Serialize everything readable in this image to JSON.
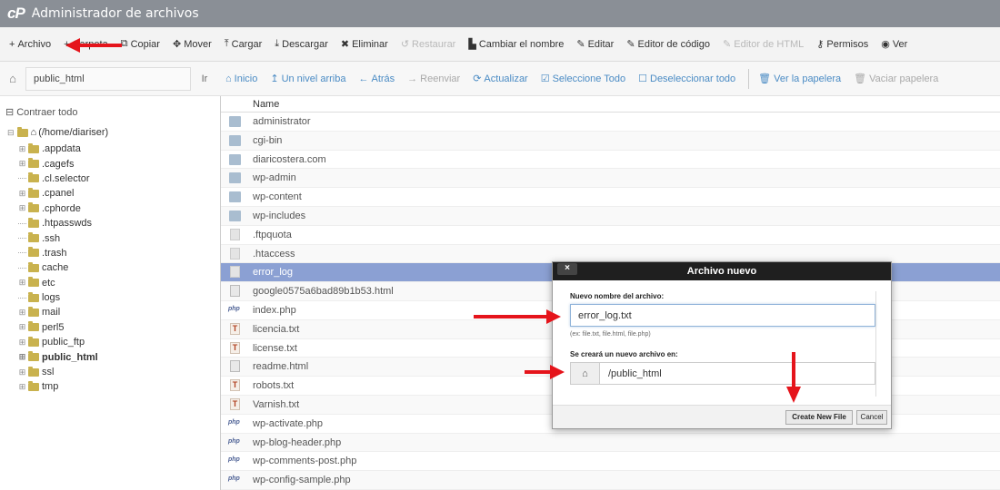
{
  "titlebar": {
    "logo": "cP",
    "title": "Administrador de archivos"
  },
  "toolbar": {
    "items": [
      {
        "label": "Archivo",
        "icon": "+",
        "disabled": false
      },
      {
        "label": "Carpeta",
        "icon": "+",
        "disabled": false
      },
      {
        "label": "Copiar",
        "icon": "⧉",
        "disabled": false
      },
      {
        "label": "Mover",
        "icon": "✥",
        "disabled": false
      },
      {
        "label": "Cargar",
        "icon": "⤒",
        "disabled": false
      },
      {
        "label": "Descargar",
        "icon": "⤓",
        "disabled": false
      },
      {
        "label": "Eliminar",
        "icon": "✖",
        "disabled": false
      },
      {
        "label": "Restaurar",
        "icon": "↺",
        "disabled": true
      },
      {
        "label": "Cambiar el nombre",
        "icon": "▙",
        "disabled": false
      },
      {
        "label": "Editar",
        "icon": "✎",
        "disabled": false
      },
      {
        "label": "Editor de código",
        "icon": "✎",
        "disabled": false
      },
      {
        "label": "Editor de HTML",
        "icon": "✎",
        "disabled": true
      },
      {
        "label": "Permisos",
        "icon": "⚷",
        "disabled": false
      },
      {
        "label": "Ver",
        "icon": "◉",
        "disabled": false
      }
    ]
  },
  "pathbar": {
    "path": "public_html",
    "go_label": "Ir",
    "nav": [
      {
        "label": "Inicio",
        "icon": "⌂",
        "disabled": false
      },
      {
        "label": "Un nivel arriba",
        "icon": "↥",
        "disabled": false
      },
      {
        "label": "Atrás",
        "icon": "←",
        "disabled": false
      },
      {
        "label": "Reenviar",
        "icon": "→",
        "disabled": true
      },
      {
        "label": "Actualizar",
        "icon": "⟳",
        "disabled": false
      },
      {
        "label": "Seleccione Todo",
        "icon": "☑",
        "disabled": false
      },
      {
        "label": "Deseleccionar todo",
        "icon": "☐",
        "disabled": false
      },
      {
        "label": "Ver la papelera",
        "icon": "🗑",
        "disabled": false
      },
      {
        "label": "Vaciar papelera",
        "icon": "🗑",
        "disabled": true
      }
    ]
  },
  "sidebar": {
    "collapse_label": "Contraer todo",
    "root_label": "(/home/diariser)",
    "items": [
      {
        "label": ".appdata",
        "expandable": true,
        "bold": false
      },
      {
        "label": ".cagefs",
        "expandable": true,
        "bold": false
      },
      {
        "label": ".cl.selector",
        "expandable": false,
        "bold": false
      },
      {
        "label": ".cpanel",
        "expandable": true,
        "bold": false
      },
      {
        "label": ".cphorde",
        "expandable": true,
        "bold": false
      },
      {
        "label": ".htpasswds",
        "expandable": false,
        "bold": false
      },
      {
        "label": ".ssh",
        "expandable": false,
        "bold": false
      },
      {
        "label": ".trash",
        "expandable": false,
        "bold": false
      },
      {
        "label": "cache",
        "expandable": false,
        "bold": false
      },
      {
        "label": "etc",
        "expandable": true,
        "bold": false
      },
      {
        "label": "logs",
        "expandable": false,
        "bold": false
      },
      {
        "label": "mail",
        "expandable": true,
        "bold": false
      },
      {
        "label": "perl5",
        "expandable": true,
        "bold": false
      },
      {
        "label": "public_ftp",
        "expandable": true,
        "bold": false
      },
      {
        "label": "public_html",
        "expandable": true,
        "bold": true
      },
      {
        "label": "ssl",
        "expandable": true,
        "bold": false
      },
      {
        "label": "tmp",
        "expandable": true,
        "bold": false
      }
    ]
  },
  "filelist": {
    "column_name": "Name",
    "rows": [
      {
        "name": "administrator",
        "type": "folder",
        "selected": false
      },
      {
        "name": "cgi-bin",
        "type": "folder",
        "selected": false
      },
      {
        "name": "diaricostera.com",
        "type": "folder",
        "selected": false
      },
      {
        "name": "wp-admin",
        "type": "folder",
        "selected": false
      },
      {
        "name": "wp-content",
        "type": "folder",
        "selected": false
      },
      {
        "name": "wp-includes",
        "type": "folder",
        "selected": false
      },
      {
        "name": ".ftpquota",
        "type": "file",
        "selected": false
      },
      {
        "name": ".htaccess",
        "type": "file",
        "selected": false
      },
      {
        "name": "error_log",
        "type": "file",
        "selected": true
      },
      {
        "name": "google0575a6bad89b1b53.html",
        "type": "html",
        "selected": false
      },
      {
        "name": "index.php",
        "type": "php",
        "selected": false
      },
      {
        "name": "licencia.txt",
        "type": "txt",
        "selected": false
      },
      {
        "name": "license.txt",
        "type": "txt",
        "selected": false
      },
      {
        "name": "readme.html",
        "type": "html",
        "selected": false
      },
      {
        "name": "robots.txt",
        "type": "txt",
        "selected": false
      },
      {
        "name": "Varnish.txt",
        "type": "txt",
        "selected": false
      },
      {
        "name": "wp-activate.php",
        "type": "php",
        "selected": false
      },
      {
        "name": "wp-blog-header.php",
        "type": "php",
        "selected": false
      },
      {
        "name": "wp-comments-post.php",
        "type": "php",
        "selected": false
      },
      {
        "name": "wp-config-sample.php",
        "type": "php",
        "selected": false
      }
    ]
  },
  "dialog": {
    "title": "Archivo nuevo",
    "close_label": "×",
    "filename_label": "Nuevo nombre del archivo:",
    "filename_value": "error_log.txt",
    "filename_hint": "(ex: file.txt, file.html, file.php)",
    "dest_label": "Se creará un nuevo archivo en:",
    "dest_value": "/public_html",
    "create_label": "Create New File",
    "cancel_label": "Cancel"
  },
  "colors": {
    "accent": "#4a8bc4",
    "selected_row": "#8ba0d3",
    "arrow": "#e5141b",
    "titlebar": "#8a8f96"
  },
  "icons": {
    "home": "home-icon",
    "folder": "folder-icon",
    "txt": "T",
    "php": "php"
  }
}
